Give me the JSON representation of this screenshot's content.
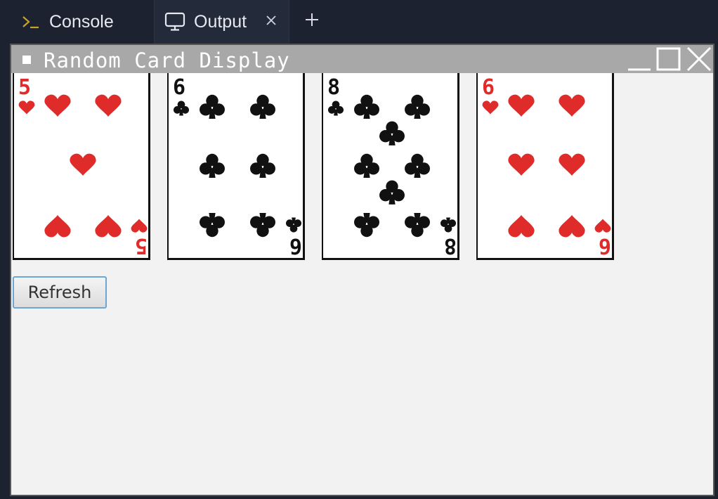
{
  "tabs": {
    "console_label": "Console",
    "output_label": "Output",
    "add_tab_label": "+"
  },
  "window": {
    "title": "Random Card Display"
  },
  "cards": [
    {
      "rank": "5",
      "suit": "hearts",
      "color": "#e02b2b"
    },
    {
      "rank": "6",
      "suit": "clubs",
      "color": "#111111"
    },
    {
      "rank": "8",
      "suit": "clubs",
      "color": "#111111"
    },
    {
      "rank": "6",
      "suit": "hearts",
      "color": "#e02b2b"
    }
  ],
  "refresh_button": {
    "label": "Refresh"
  },
  "colors": {
    "ide_background": "#1c2230",
    "active_tab": "#232a3a",
    "window_titlebar": "#a8a8a8",
    "content_background": "#f2f2f2",
    "hearts_red": "#e02b2b",
    "clubs_black": "#111111",
    "button_focus_border": "#6aa6d6"
  }
}
